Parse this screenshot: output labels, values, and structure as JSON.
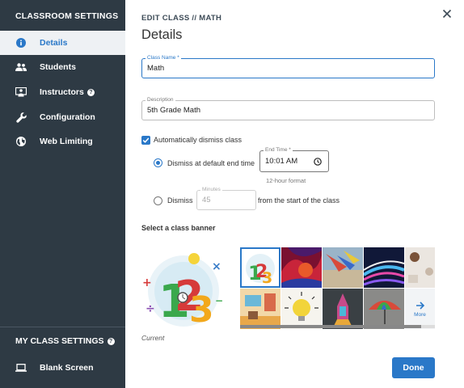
{
  "sidebar": {
    "header": "CLASSROOM SETTINGS",
    "items": [
      {
        "label": "Details",
        "icon": "info-icon"
      },
      {
        "label": "Students",
        "icon": "people-icon"
      },
      {
        "label": "Instructors",
        "icon": "presenter-icon"
      },
      {
        "label": "Configuration",
        "icon": "wrench-icon"
      },
      {
        "label": "Web Limiting",
        "icon": "globe-icon"
      }
    ],
    "my_header": "MY CLASS SETTINGS",
    "my_items": [
      {
        "label": "Blank Screen",
        "icon": "laptop-icon"
      }
    ]
  },
  "breadcrumb": "EDIT CLASS  //  MATH",
  "title": "Details",
  "class_name": {
    "label": "Class Name *",
    "value": "Math"
  },
  "description": {
    "label": "Description",
    "value": "5th Grade Math"
  },
  "auto_dismiss": {
    "label": "Automatically dismiss class",
    "checked": true
  },
  "dismiss_default": {
    "label": "Dismiss at default end time",
    "selected": true
  },
  "end_time": {
    "label": "End Time *",
    "value": "10:01  AM",
    "hint": "12-hour format"
  },
  "dismiss_minutes": {
    "label": "Dismiss",
    "minutes_label": "Minutes",
    "minutes_value": "45",
    "suffix": "from the start of the class",
    "selected": false
  },
  "banner": {
    "heading": "Select a class banner",
    "current_label": "Current",
    "more_label": "More",
    "tiles": [
      "math-numbers",
      "abstract-red",
      "kite-beach",
      "light-streaks",
      "coffee-desk",
      "classroom",
      "lightbulb",
      "chalkboard-rocket",
      "umbrella"
    ]
  },
  "done_label": "Done",
  "colors": {
    "accent": "#2a78c8",
    "sidebar": "#2e3a44"
  }
}
